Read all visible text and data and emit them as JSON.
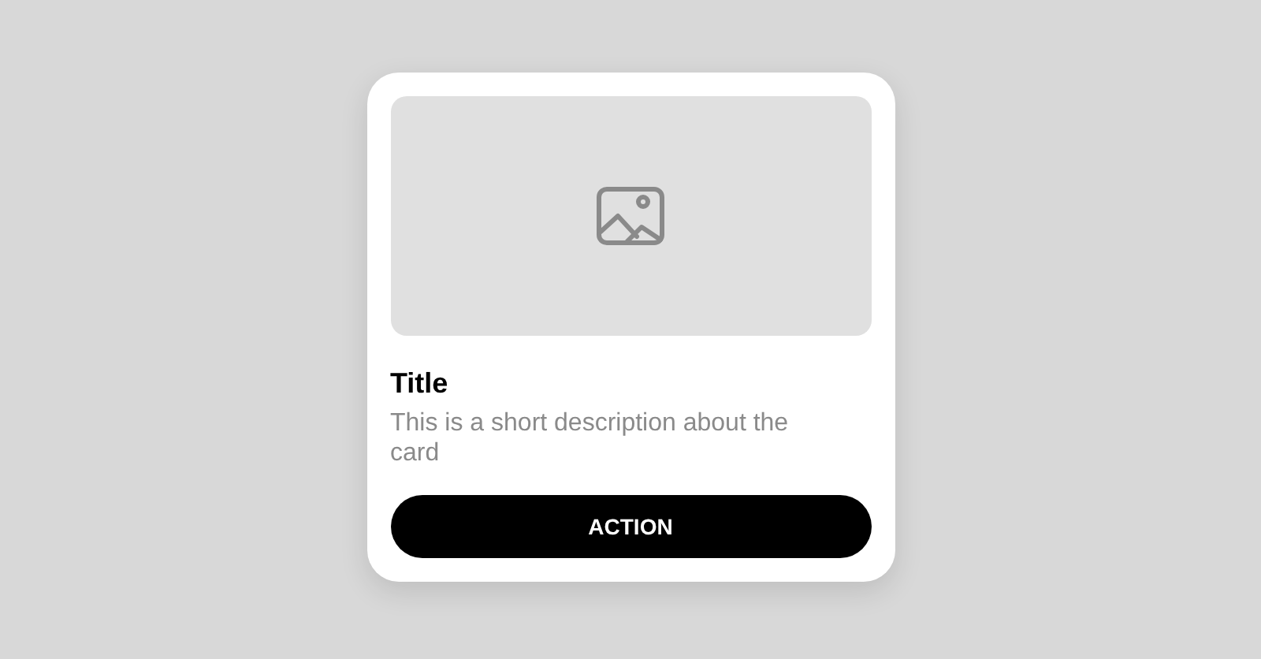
{
  "card": {
    "title": "Title",
    "description": "This is a short description about the card",
    "button": "ACTION"
  }
}
